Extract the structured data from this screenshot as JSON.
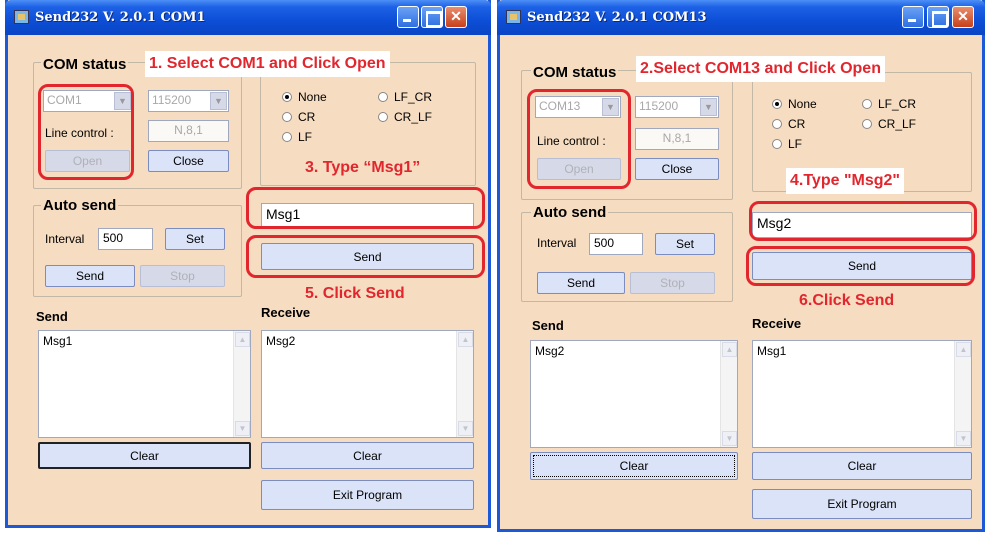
{
  "left": {
    "title": "Send232  V. 2.0.1  COM1",
    "com_status_label": "COM status",
    "port": "COM1",
    "baud": "115200",
    "line_control_label": "Line control :",
    "line_control_value": "N,8,1",
    "open_label": "Open",
    "close_label": "Close",
    "radio_none": "None",
    "radio_cr": "CR",
    "radio_lf": "LF",
    "radio_lf_cr": "LF_CR",
    "radio_cr_lf": "CR_LF",
    "auto_send_label": "Auto send",
    "interval_label": "Interval",
    "interval_value": "500",
    "set_label": "Set",
    "send_small_label": "Send",
    "stop_label": "Stop",
    "message_value": "Msg1",
    "send_label": "Send",
    "send_section_label": "Send",
    "receive_section_label": "Receive",
    "send_log": "Msg1",
    "receive_log": "Msg2",
    "clear_label": "Clear",
    "exit_label": "Exit Program",
    "callout_select": "1. Select COM1 and Click Open",
    "callout_type": "3. Type “Msg1”",
    "callout_send": "5. Click Send"
  },
  "right": {
    "title": "Send232  V. 2.0.1  COM13",
    "com_status_label": "COM status",
    "port": "COM13",
    "baud": "115200",
    "line_control_label": "Line control :",
    "line_control_value": "N,8,1",
    "open_label": "Open",
    "close_label": "Close",
    "radio_none": "None",
    "radio_cr": "CR",
    "radio_lf": "LF",
    "radio_lf_cr": "LF_CR",
    "radio_cr_lf": "CR_LF",
    "auto_send_label": "Auto send",
    "interval_label": "Interval",
    "interval_value": "500",
    "set_label": "Set",
    "send_small_label": "Send",
    "stop_label": "Stop",
    "message_value": "Msg2",
    "send_label": "Send",
    "send_section_label": "Send",
    "receive_section_label": "Receive",
    "send_log": "Msg2",
    "receive_log": "Msg1",
    "clear_label": "Clear",
    "exit_label": "Exit Program",
    "callout_select": "2.Select COM13 and Click Open",
    "callout_type": "4.Type \"Msg2\"",
    "callout_send": "6.Click Send"
  },
  "icons": {
    "close": "✕",
    "arrow_down": "▼",
    "arrow_up": "▲"
  }
}
